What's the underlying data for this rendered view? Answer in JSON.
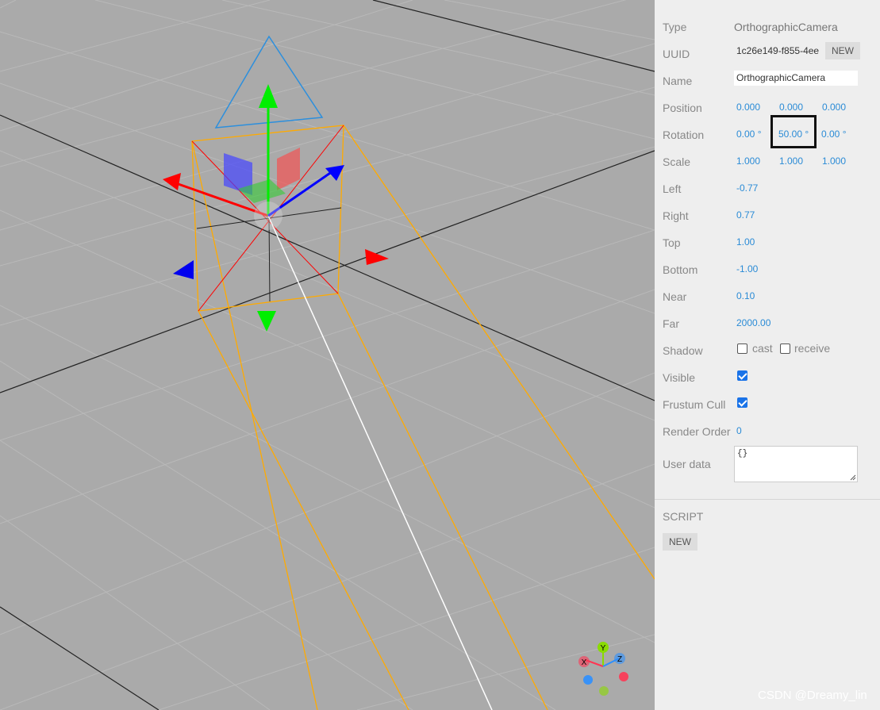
{
  "viewport": {
    "background": "#aaaaaa",
    "helper": {
      "axes": [
        "X",
        "Y",
        "Z"
      ],
      "colors": {
        "x": "#ff3653",
        "y": "#8adb00",
        "z": "#2c8fff"
      }
    }
  },
  "panel": {
    "type": {
      "label": "Type",
      "value": "OrthographicCamera"
    },
    "uuid": {
      "label": "UUID",
      "value": "1c26e149-f855-4ee",
      "button": "NEW"
    },
    "name": {
      "label": "Name",
      "value": "OrthographicCamera"
    },
    "position": {
      "label": "Position",
      "x": "0.000",
      "y": "0.000",
      "z": "0.000"
    },
    "rotation": {
      "label": "Rotation",
      "x": "0.00 °",
      "y": "50.00 °",
      "z": "0.00 °"
    },
    "scale": {
      "label": "Scale",
      "x": "1.000",
      "y": "1.000",
      "z": "1.000"
    },
    "left": {
      "label": "Left",
      "value": "-0.77"
    },
    "right": {
      "label": "Right",
      "value": "0.77"
    },
    "top": {
      "label": "Top",
      "value": "1.00"
    },
    "bottom": {
      "label": "Bottom",
      "value": "-1.00"
    },
    "near": {
      "label": "Near",
      "value": "0.10"
    },
    "far": {
      "label": "Far",
      "value": "2000.00"
    },
    "shadow": {
      "label": "Shadow",
      "cast_label": "cast",
      "receive_label": "receive",
      "cast": false,
      "receive": false
    },
    "visible": {
      "label": "Visible",
      "checked": true
    },
    "frustum_cull": {
      "label": "Frustum Cull",
      "checked": true
    },
    "render_order": {
      "label": "Render Order",
      "value": "0"
    },
    "user_data": {
      "label": "User data",
      "value": "{}"
    },
    "script": {
      "title": "SCRIPT",
      "button": "NEW"
    }
  },
  "watermark": "CSDN @Dreamy_lin"
}
